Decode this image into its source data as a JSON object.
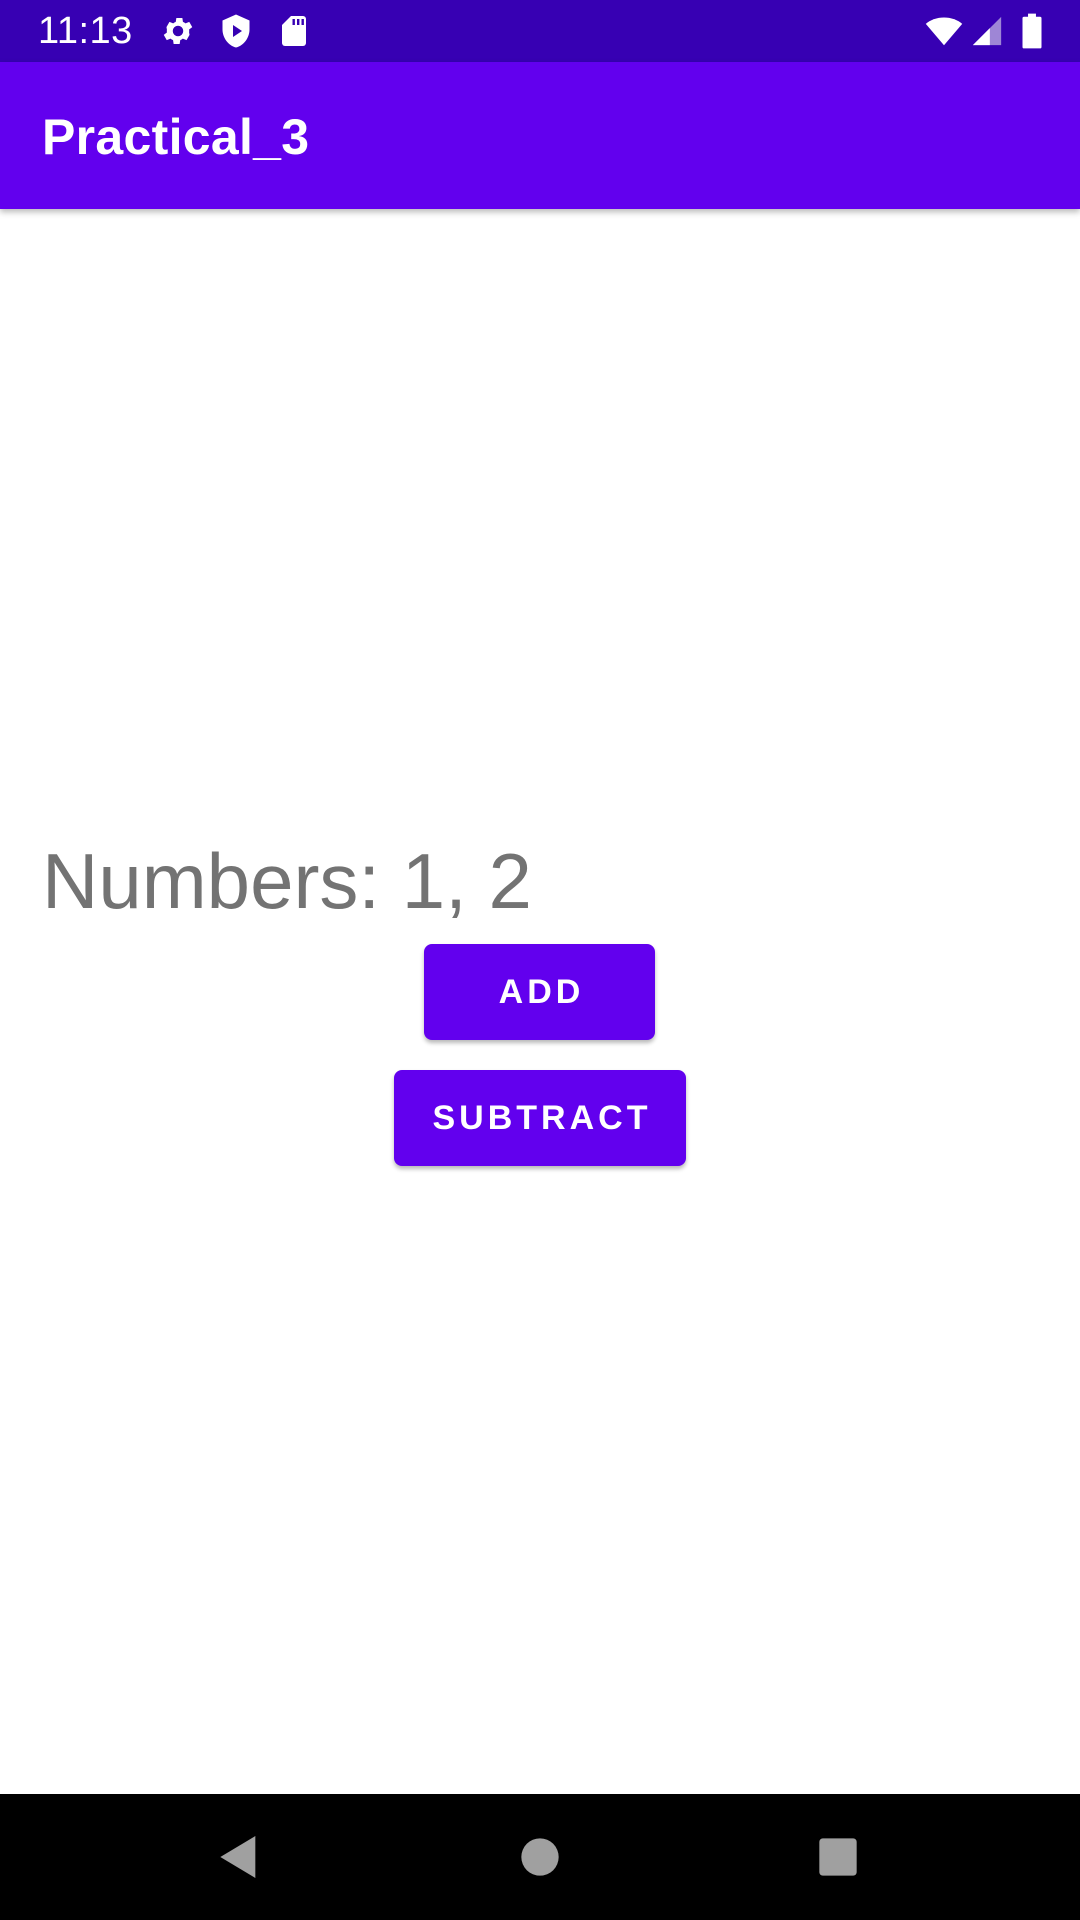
{
  "status_bar": {
    "time": "11:13",
    "icons_left": [
      "settings-icon",
      "shield-play-icon",
      "sd-card-icon"
    ],
    "icons_right": [
      "wifi-icon",
      "cell-signal-icon",
      "battery-icon"
    ],
    "background": "#3700b3"
  },
  "app_bar": {
    "title": "Practical_3",
    "background": "#6200ee"
  },
  "main": {
    "numbers_text": "Numbers: 1, 2",
    "add_button": "ADD",
    "subtract_button": "SUBTRACT",
    "button_color": "#6200ee",
    "text_color": "#737373"
  },
  "nav_bar": {
    "buttons": [
      "back-icon",
      "home-icon",
      "recents-icon"
    ]
  }
}
